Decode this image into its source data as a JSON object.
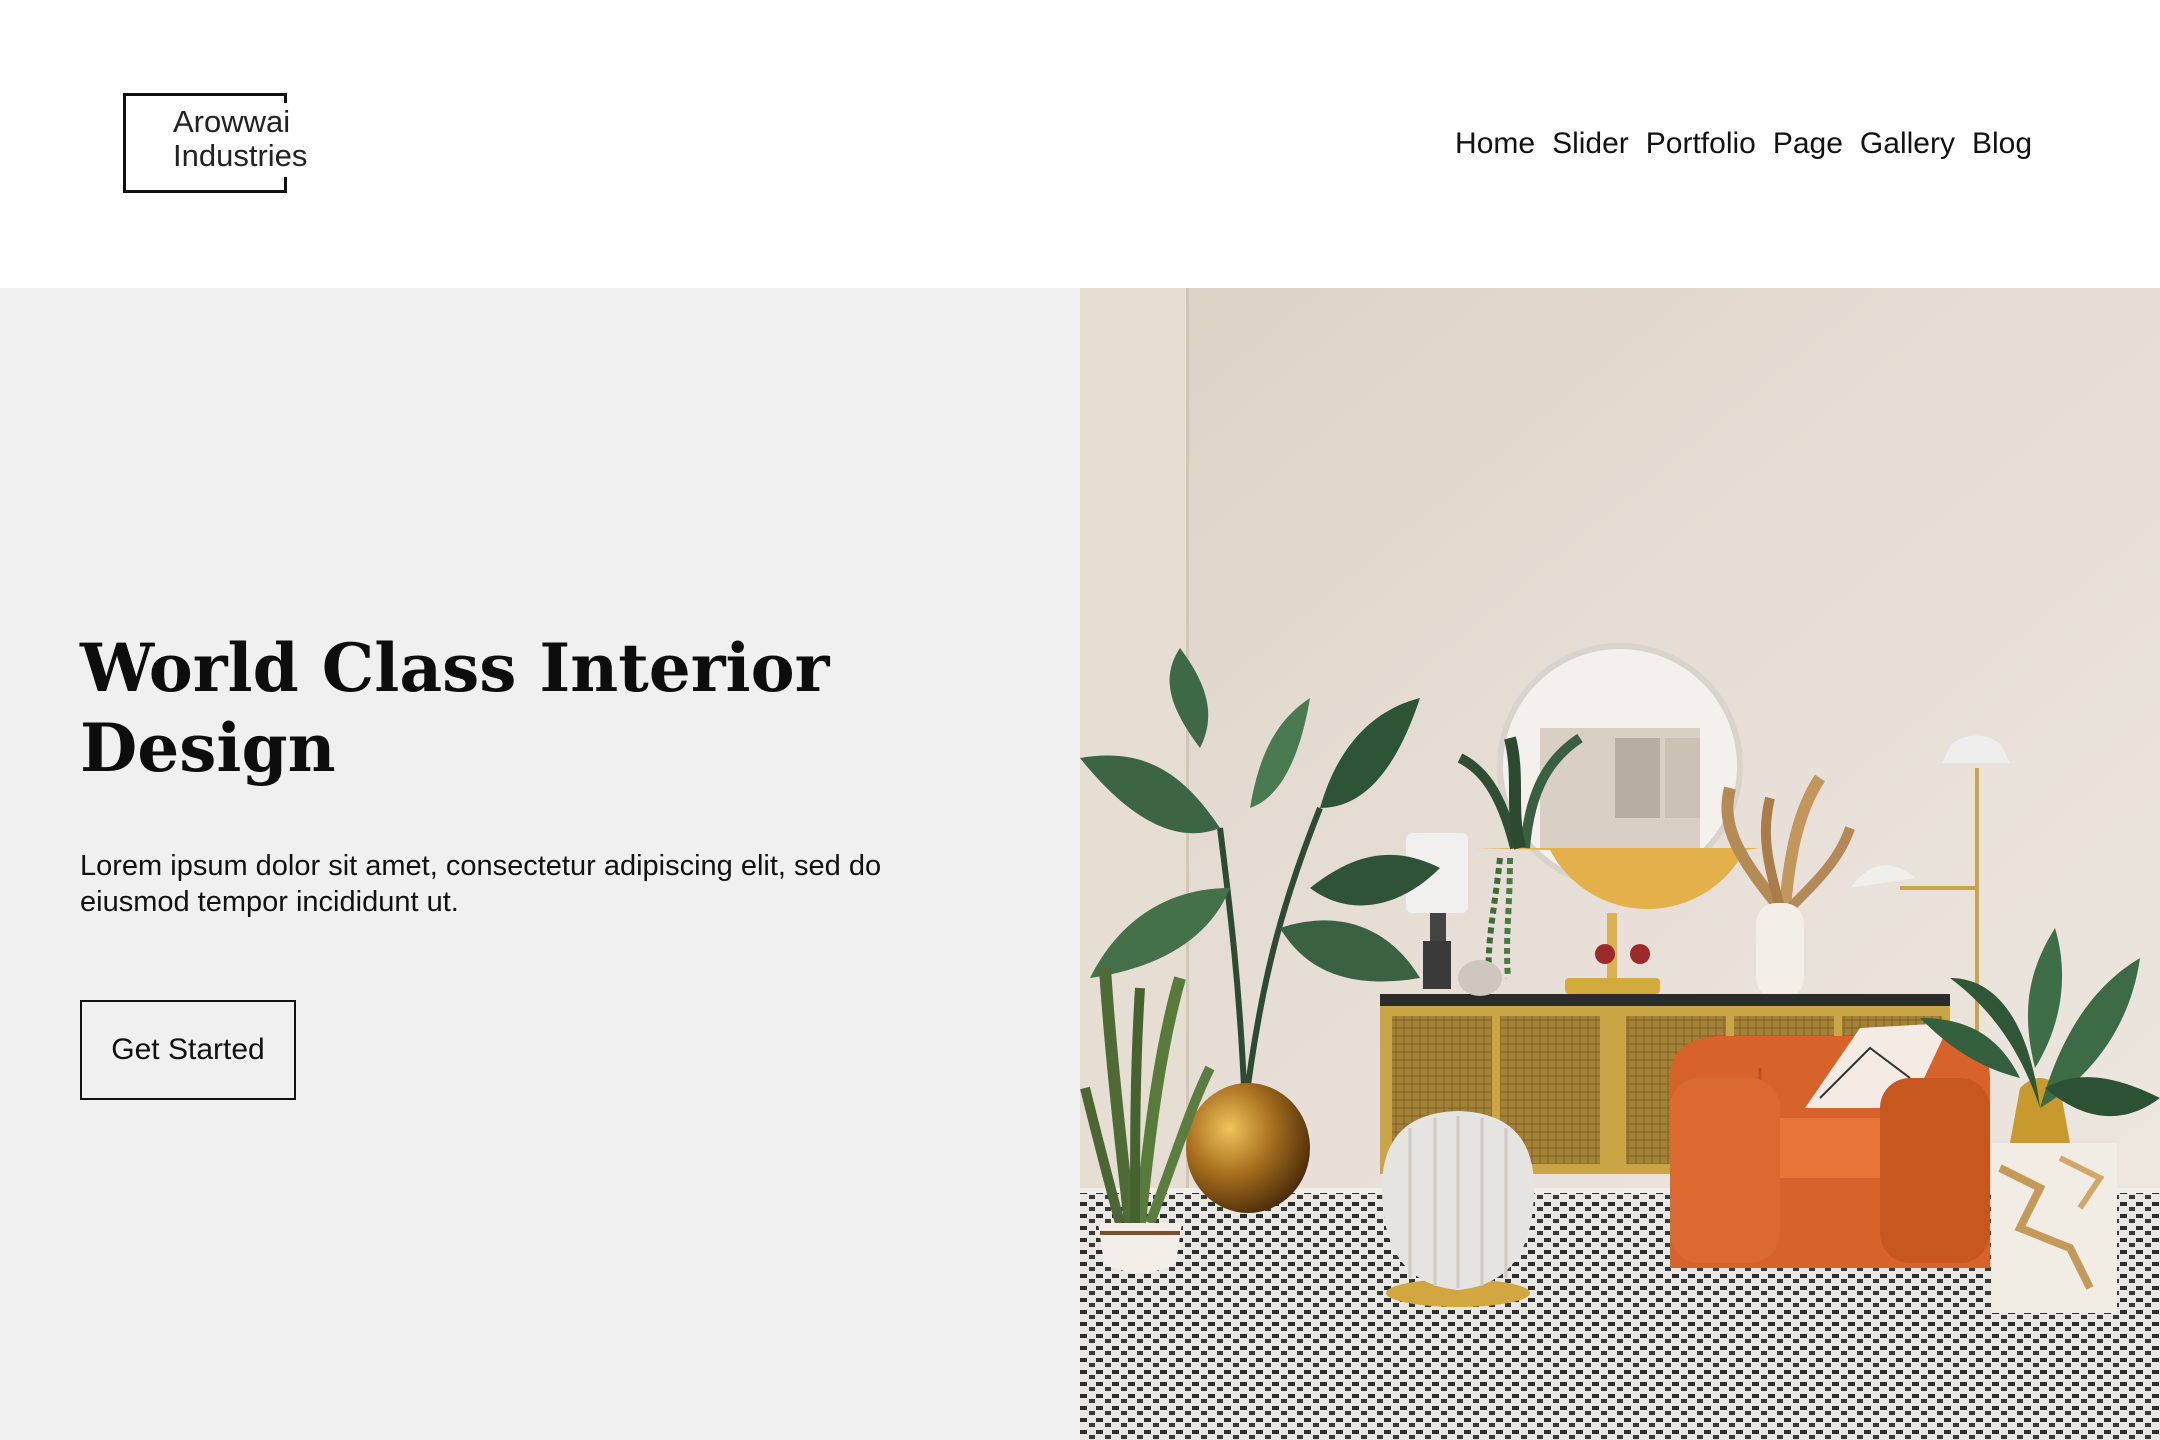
{
  "brand": {
    "line1": "Arowwai",
    "line2": "Industries"
  },
  "nav": {
    "items": [
      {
        "label": "Home",
        "name": "nav-home"
      },
      {
        "label": "Slider",
        "name": "nav-slider"
      },
      {
        "label": "Portfolio",
        "name": "nav-portfolio"
      },
      {
        "label": "Page",
        "name": "nav-page"
      },
      {
        "label": "Gallery",
        "name": "nav-gallery"
      },
      {
        "label": "Blog",
        "name": "nav-blog"
      }
    ]
  },
  "hero": {
    "title": "World Class Interior Design",
    "description": "Lorem ipsum dolor sit amet, consectetur adipiscing elit, sed do eiusmod tempor incididunt ut.",
    "cta_label": "Get Started"
  },
  "colors": {
    "header_bg": "#ffffff",
    "hero_left_bg": "#f0f0f0",
    "text": "#111111",
    "accent_orange": "#e2672b",
    "accent_gold": "#c9a227"
  }
}
